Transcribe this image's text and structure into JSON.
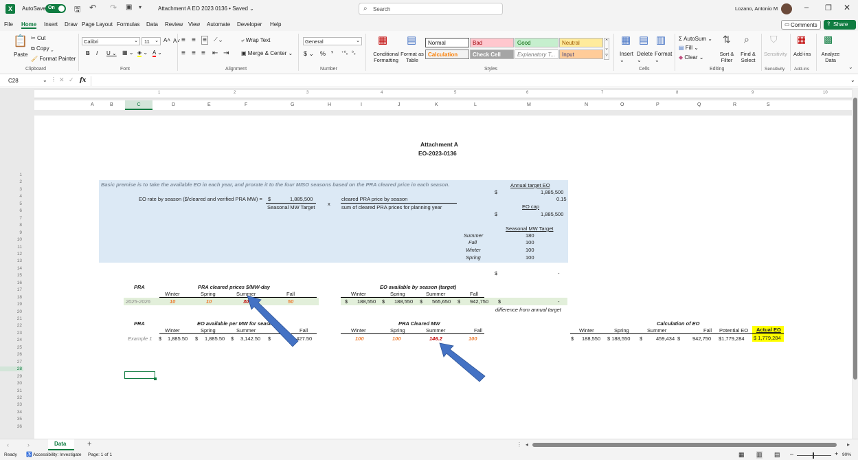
{
  "titlebar": {
    "autosave": "AutoSave",
    "toggle": "On",
    "title": "Attachment A EO 2023 0136 • Saved ⌄",
    "search_placeholder": "Search",
    "user": "Lozano, Antonio M"
  },
  "menu": {
    "items": [
      "File",
      "Home",
      "Insert",
      "Draw",
      "Page Layout",
      "Formulas",
      "Data",
      "Review",
      "View",
      "Automate",
      "Developer",
      "Help"
    ],
    "comments": "Comments",
    "share": "Share"
  },
  "ribbon": {
    "clipboard": {
      "paste": "Paste",
      "cut": "Cut",
      "copy": "Copy",
      "format_painter": "Format Painter",
      "group": "Clipboard"
    },
    "font": {
      "name": "Calibri",
      "size": "11",
      "group": "Font"
    },
    "alignment": {
      "wrap": "Wrap Text",
      "merge": "Merge & Center",
      "group": "Alignment"
    },
    "number": {
      "format": "General",
      "group": "Number"
    },
    "styles": {
      "conditional": "Conditional Formatting",
      "format_as_table": "Format as Table",
      "normal": "Normal",
      "bad": "Bad",
      "good": "Good",
      "neutral": "Neutral",
      "calculation": "Calculation",
      "check_cell": "Check Cell",
      "explanatory": "Explanatory T...",
      "input": "Input",
      "group": "Styles"
    },
    "cells": {
      "insert": "Insert",
      "delete": "Delete",
      "format": "Format",
      "group": "Cells"
    },
    "editing": {
      "autosum": "AutoSum",
      "fill": "Fill",
      "clear": "Clear",
      "sort": "Sort & Filter",
      "find": "Find & Select",
      "group": "Editing"
    },
    "sensitivity": {
      "label": "Sensitivity",
      "group": "Sensitivity"
    },
    "addins": {
      "label": "Add-ins",
      "group": "Add-ins"
    },
    "analyze": {
      "label": "Analyze Data"
    }
  },
  "formula_bar": {
    "name_box": "C28",
    "fx": "fx",
    "value": ""
  },
  "ruler": [
    "1",
    "2",
    "3",
    "4",
    "5",
    "6",
    "7",
    "8",
    "9",
    "10"
  ],
  "columns": [
    "A",
    "B",
    "C",
    "D",
    "E",
    "F",
    "G",
    "H",
    "I",
    "J",
    "K",
    "L",
    "M",
    "N",
    "O",
    "P",
    "Q",
    "R",
    "S"
  ],
  "rows": [
    "1",
    "2",
    "3",
    "4",
    "5",
    "6",
    "7",
    "8",
    "9",
    "10",
    "11",
    "12",
    "13",
    "14",
    "15",
    "16",
    "17",
    "18",
    "19",
    "20",
    "21",
    "22",
    "23",
    "24",
    "25",
    "26",
    "27",
    "28",
    "29",
    "30",
    "31",
    "32",
    "33",
    "34",
    "35",
    "36"
  ],
  "sheet": {
    "title1": "Attachment A",
    "title2": "EO-2023-0136",
    "premise": "Basic premise is to take the available EO in each year, and prorate it to the four MISO seasons based on the PRA cleared price in each season.",
    "eo_rate_label": "EO rate by season ($/cleared and verified PRA MW) =",
    "eo_rate_dollar": "$",
    "eo_rate_value": "1,885,500",
    "seasonal_mw_target": "Seasonal MW Target",
    "times": "x",
    "cleared_price_label": "cleared PRA price by season",
    "sum_cleared_label": "sum of cleared PRA prices for planning year",
    "annual_target_label": "Annual target EO",
    "annual_target_dollar": "$",
    "annual_target_value": "1,885,500",
    "pct": "0.15",
    "eo_cap_label": "EO cap",
    "eo_cap_dollar": "$",
    "eo_cap_value": "1,885,500",
    "seasonal_target_label": "Seasonal MW Target",
    "seasonal_targets": [
      {
        "season": "Summer",
        "value": "180"
      },
      {
        "season": "Fall",
        "value": "100"
      },
      {
        "season": "Winter",
        "value": "100"
      },
      {
        "season": "Spring",
        "value": "100"
      }
    ],
    "row14_dollar": "$",
    "row14_value": "-",
    "pra_label": "PRA",
    "pra_prices_title": "PRA cleared prices $/MW-day",
    "seasons": [
      "Winter",
      "Spring",
      "Summer",
      "Fall"
    ],
    "pra_year": "2025-2026",
    "pra_prices": [
      "10",
      "10",
      "30",
      "50"
    ],
    "eo_available_title": "EO available by season (target)",
    "eo_available": [
      {
        "d": "$",
        "v": "188,550"
      },
      {
        "d": "$",
        "v": "188,550"
      },
      {
        "d": "$",
        "v": "565,650"
      },
      {
        "d": "$",
        "v": "942,750"
      }
    ],
    "diff_dollar": "$",
    "diff_value": "-",
    "diff_label": "difference from annual target",
    "pra_label2": "PRA",
    "eo_per_mw_title": "EO available per MW for season",
    "example": "Example 1",
    "eo_per_mw": [
      {
        "d": "$",
        "v": "1,885.50"
      },
      {
        "d": "$",
        "v": "1,885.50"
      },
      {
        "d": "$",
        "v": "3,142.50"
      },
      {
        "d": "$",
        "v": "9,427.50"
      }
    ],
    "pra_cleared_mw_title": "PRA Cleared MW",
    "pra_cleared_mw": [
      "100",
      "100",
      "146.2",
      "100"
    ],
    "calc_title": "Calculation of EO",
    "calc_headers": [
      "Winter",
      "Spring",
      "Summer",
      "Fall",
      "Potential EO",
      "Actual EO"
    ],
    "calc_values": [
      {
        "d": "$",
        "v": "188,550"
      },
      {
        "d": "",
        "v": "$ 188,550"
      },
      {
        "d": "$",
        "v": "459,434"
      },
      {
        "d": "$",
        "v": "942,750"
      },
      {
        "d": "",
        "v": "$1,779,284"
      },
      {
        "d": "",
        "v": "$ 1,779,284"
      }
    ]
  },
  "tabs": {
    "sheet": "Data",
    "add": "+"
  },
  "status": {
    "ready": "Ready",
    "accessibility": "Accessibility: Investigate",
    "page": "Page: 1 of 1",
    "zoom": "90%"
  },
  "colors": {
    "blue_fill": "#dce9f5",
    "green_fill": "#e2efda",
    "yellow": "#ffff00",
    "arrow": "#4472c4",
    "excel_green": "#107c41"
  }
}
